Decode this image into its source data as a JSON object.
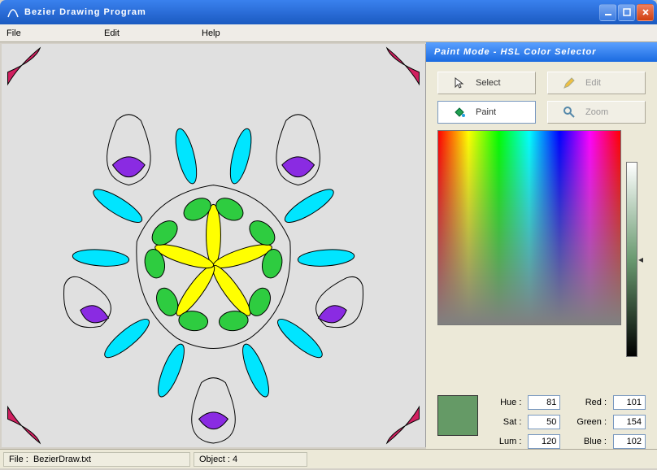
{
  "window": {
    "title": "Bezier Drawing Program"
  },
  "menu": {
    "file": "File",
    "edit": "Edit",
    "help": "Help"
  },
  "side": {
    "header": "Paint Mode - HSL Color Selector",
    "tools": {
      "select": "Select",
      "edit": "Edit",
      "paint": "Paint",
      "zoom": "Zoom"
    },
    "labels": {
      "hue": "Hue :",
      "sat": "Sat :",
      "lum": "Lum :",
      "red": "Red :",
      "green": "Green :",
      "blue": "Blue :"
    },
    "values": {
      "hue": "81",
      "sat": "50",
      "lum": "120",
      "red": "101",
      "green": "154",
      "blue": "102"
    },
    "swatch_color": "#659a66"
  },
  "status": {
    "file_label": "File :",
    "file_name": "BezierDraw.txt",
    "object_label": "Object :",
    "object_count": "4"
  }
}
